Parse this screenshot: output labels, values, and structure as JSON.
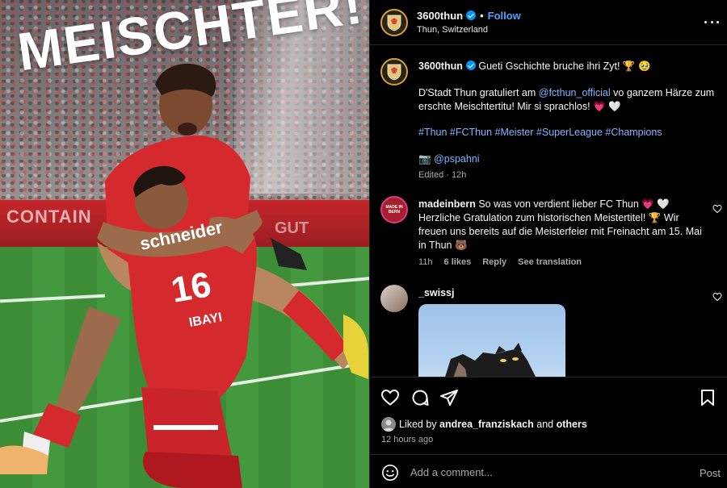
{
  "photo": {
    "headline": "MEISCHTER!",
    "sponsor_text": "Schneider",
    "jersey_number": "16",
    "jersey_name": "IBAYI",
    "adboard_left": "CONTAIN",
    "adboard_right": "GUT"
  },
  "header": {
    "username": "3600thun",
    "follow_label": "Follow",
    "location": "Thun, Switzerland"
  },
  "caption": {
    "username": "3600thun",
    "line1": "Gueti Gschichte bruche ihri Zyt! 🏆 🥹",
    "para_prefix": "D'Stadt Thun gratuliert am ",
    "mention": "@fcthun_official",
    "para_suffix": " vo ganzem Härze zum erschte Meischtertitu! Mir si sprachlos! 💗 🤍",
    "hashtags": "#Thun #FCThun #Meister #SuperLeague #Champions",
    "photo_credit_icon": "📷",
    "photo_credit": "@pspahni",
    "edited": "Edited · 12h"
  },
  "comment1": {
    "username": "madeinbern",
    "avatar_text": "MADE IN BERN",
    "text": "So was von verdient lieber FC Thun 💗 🤍 Herzliche Gratulation zum historischen Meistertitel! 🏆 Wir freuen uns bereits auf die Meisterfeier mit Freinacht am 15. Mai in Thun 🐻",
    "time": "11h",
    "likes": "6 likes",
    "reply": "Reply",
    "see_translation": "See translation"
  },
  "comment2": {
    "username": "_swissj"
  },
  "actions": {
    "liked_prefix": "Liked by ",
    "liked_user": "andrea_franziskach",
    "liked_and": " and ",
    "liked_others": "others",
    "time_ago": "12 hours ago"
  },
  "compose": {
    "placeholder": "Add a comment...",
    "post_label": "Post"
  },
  "colors": {
    "accent_blue": "#0095f6",
    "link_blue": "#7fb4ff",
    "background": "#000000",
    "jersey_red": "#d42a2e"
  }
}
